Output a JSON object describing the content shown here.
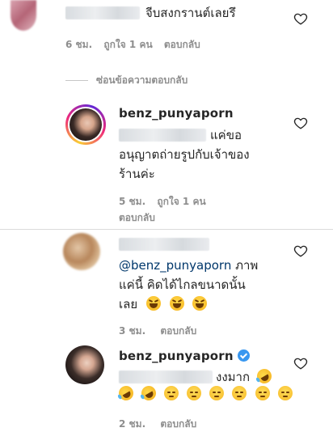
{
  "comments": [
    {
      "username": "",
      "text": "จีบสงกรานต์เลยรึ",
      "time": "6 ชม.",
      "likes": "ถูกใจ 1 คน",
      "reply_label": "ตอบกลับ"
    },
    {
      "username": "",
      "mention": "@benz_punyaporn",
      "text_line1_rest": " ภาพ",
      "text_line2": "แค่นี้ คิดได้ไกลขนาดนั้น",
      "text_line3": "เลย",
      "time": "3 ชม.",
      "reply_label": "ตอบกลับ"
    }
  ],
  "replies_toggle": "ซ่อนข้อความตอบกลับ",
  "replies": [
    {
      "username": "benz_punyaporn",
      "text_line1": "แค่ขอ",
      "text_line2": "อนุญาตถ่ายรูปกับเจ้าของ",
      "text_line3": "ร้านค่ะ",
      "time": "5 ชม.",
      "likes": "ถูกใจ 1 คน",
      "reply_label": "ตอบกลับ"
    },
    {
      "username": "benz_punyaporn",
      "verified": true,
      "text_line1": "งงมาก",
      "time": "2 ชม.",
      "reply_label": "ตอบกลับ"
    }
  ],
  "icons": {
    "like": "heart-outline-icon",
    "verified": "verified-badge-icon"
  },
  "colors": {
    "text": "#262626",
    "meta": "#8e8e8e",
    "mention": "#00376b",
    "verified": "#3897f0"
  }
}
